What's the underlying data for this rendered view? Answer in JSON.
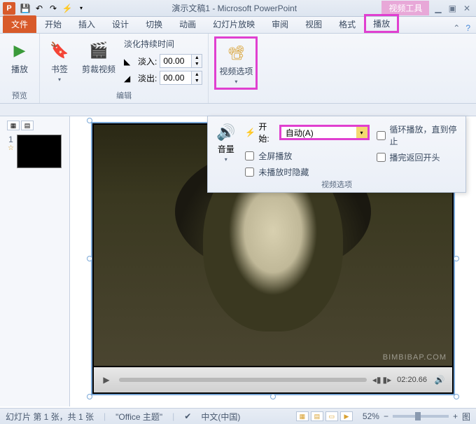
{
  "title": "演示文稿1 - Microsoft PowerPoint",
  "context_tab": "视频工具",
  "app_icon_letter": "P",
  "tabs": {
    "file": "文件",
    "home": "开始",
    "insert": "插入",
    "design": "设计",
    "trans": "切换",
    "anim": "动画",
    "slideshow": "幻灯片放映",
    "review": "审阅",
    "view": "视图",
    "format": "格式",
    "playback": "播放"
  },
  "ribbon": {
    "preview_group": "预览",
    "play": "播放",
    "bookmark": "书签",
    "trim": "剪裁视频",
    "edit_group": "编辑",
    "fade_title": "淡化持续时间",
    "fade_in_label": "淡入:",
    "fade_out_label": "淡出:",
    "fade_in_val": "00.00",
    "fade_out_val": "00.00",
    "video_opts": "视频选项"
  },
  "popup": {
    "volume": "音量",
    "start_label": "开始:",
    "start_value": "自动(A)",
    "fullscreen": "全屏播放",
    "hide": "未播放时隐藏",
    "loop": "循环播放，直到停止",
    "rewind": "播完返回开头",
    "group_label": "视频选项"
  },
  "thumb": {
    "num": "1",
    "star": "☆"
  },
  "player": {
    "time": "02:20.66",
    "watermark": "BIMBIBAP.COM"
  },
  "status": {
    "slide_info": "幻灯片 第 1 张，共 1 张",
    "theme": "\"Office 主题\"",
    "lang": "中文(中国)",
    "zoom": "52%",
    "fit": "图"
  }
}
